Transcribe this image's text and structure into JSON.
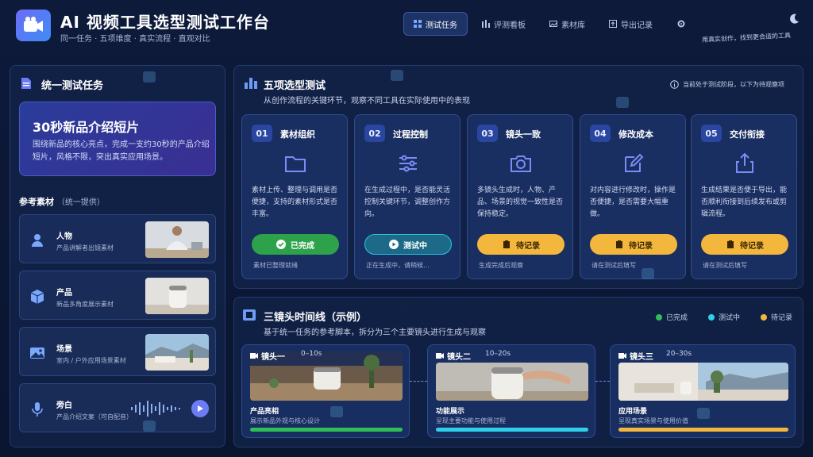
{
  "header": {
    "title": "AI 视频工具选型测试工作台",
    "subtitle": "同一任务 · 五项维度 · 真实流程 · 直观对比",
    "nav": [
      {
        "label": "测试任务",
        "icon": "grid-icon",
        "active": true
      },
      {
        "label": "评测看板",
        "icon": "bar-chart-icon",
        "active": false
      },
      {
        "label": "素材库",
        "icon": "image-icon",
        "active": false
      },
      {
        "label": "导出记录",
        "icon": "export-icon",
        "active": false
      }
    ],
    "slogan": "用真实创作，找到更合适的工具"
  },
  "task": {
    "section_title": "统一测试任务",
    "title": "30秒新品介绍短片",
    "desc": "围绕新品的核心亮点，完成一支约30秒的产品介绍短片，风格不限，突出真实应用场景。",
    "ref_title": "参考素材",
    "ref_note": "（统一提供）",
    "refs": [
      {
        "name": "人物",
        "sub": "产品讲解者出镜素材",
        "icon": "person-icon"
      },
      {
        "name": "产品",
        "sub": "新品多角度展示素材",
        "icon": "cube-icon"
      },
      {
        "name": "场景",
        "sub": "室内 / 户外应用场景素材",
        "icon": "landscape-icon"
      },
      {
        "name": "旁白",
        "sub": "产品介绍文案（可自配音）",
        "icon": "microphone-icon"
      }
    ]
  },
  "steps_panel": {
    "title": "五项选型测试",
    "subtitle": "从创作流程的关键环节，观察不同工具在实际使用中的表现",
    "hint": "当前处于测试阶段，以下为待观察项",
    "steps": [
      {
        "num": "01",
        "name": "素材组织",
        "desc": "素材上传、整理与调用是否便捷，支持的素材形式是否丰富。",
        "status": "已完成",
        "note": "素材已整理就绪",
        "icon": "folder-icon"
      },
      {
        "num": "02",
        "name": "过程控制",
        "desc": "在生成过程中，是否能灵活控制关键环节，调整创作方向。",
        "status": "测试中",
        "note": "正在生成中，请稍候...",
        "icon": "sliders-icon"
      },
      {
        "num": "03",
        "name": "镜头一致",
        "desc": "多镜头生成时，人物、产品、场景的视觉一致性是否保持稳定。",
        "status": "待记录",
        "note": "生成完成后观察",
        "icon": "camera-icon"
      },
      {
        "num": "04",
        "name": "修改成本",
        "desc": "对内容进行修改时，操作是否便捷，是否需要大幅重做。",
        "status": "待记录",
        "note": "请在测试后填写",
        "icon": "edit-icon"
      },
      {
        "num": "05",
        "name": "交付衔接",
        "desc": "生成结果是否便于导出，能否顺利衔接到后续发布或剪辑流程。",
        "status": "待记录",
        "note": "请在测试后填写",
        "icon": "share-icon"
      }
    ]
  },
  "timeline": {
    "title": "三镜头时间线（示例）",
    "subtitle": "基于统一任务的参考脚本，拆分为三个主要镜头进行生成与观察",
    "legend": [
      {
        "label": "已完成",
        "color": "#2fbf5a"
      },
      {
        "label": "测试中",
        "color": "#2fd0ea"
      },
      {
        "label": "待记录",
        "color": "#f3b73e"
      }
    ],
    "shots": [
      {
        "label": "镜头一",
        "time": "0–10s",
        "name": "产品亮相",
        "desc": "展示新品外观与核心设计",
        "color": "#2fbf5a"
      },
      {
        "label": "镜头二",
        "time": "10–20s",
        "name": "功能展示",
        "desc": "呈现主要功能与使用过程",
        "color": "#2fd0ea"
      },
      {
        "label": "镜头三",
        "time": "20–30s",
        "name": "应用场景",
        "desc": "呈现真实场景与使用价值",
        "color": "#f3b73e"
      }
    ]
  }
}
